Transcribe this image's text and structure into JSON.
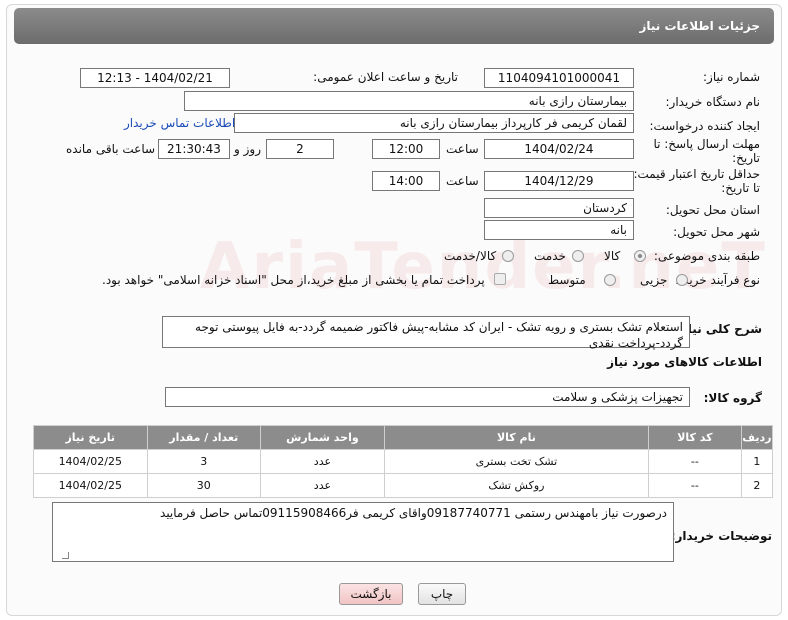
{
  "header": {
    "title": "جزئیات اطلاعات نیاز"
  },
  "fields": {
    "need_number_label": "شماره نیاز:",
    "need_number": "1104094101000041",
    "announce_label": "تاریخ و ساعت اعلان عمومی:",
    "announce_value": "1404/02/21 - 12:13",
    "buyer_org_label": "نام دستگاه خریدار:",
    "buyer_org": "بیمارستان رازی بانه",
    "creator_label": "ایجاد کننده درخواست:",
    "creator": "لقمان کریمی فر کارپرداز بیمارستان رازی بانه",
    "buyer_contact_link": "اطلاعات تماس خریدار",
    "reply_deadline_label_1": "مهلت ارسال پاسخ: تا",
    "reply_deadline_label_2": "تاریخ:",
    "reply_date": "1404/02/24",
    "time_label": "ساعت",
    "reply_time": "12:00",
    "days_value": "2",
    "days_label": "روز و",
    "remaining_time": "21:30:43",
    "remaining_label": "ساعت باقی مانده",
    "price_validity_label_1": "حداقل تاریخ اعتبار قیمت:",
    "price_validity_label_2": "تا تاریخ:",
    "price_date": "1404/12/29",
    "price_time": "14:00",
    "province_label": "استان محل تحویل:",
    "province": "کردستان",
    "city_label": "شهر محل تحویل:",
    "city": "بانه",
    "category_label": "طبقه بندی موضوعی:",
    "category_options": [
      "کالا",
      "خدمت",
      "کالا/خدمت"
    ],
    "process_label": "نوع فرآیند خرید :",
    "process_options": [
      "جزیی",
      "متوسط"
    ],
    "payment_note": "پرداخت تمام یا بخشی از مبلغ خرید،از محل \"اسناد خزانه اسلامی\" خواهد بود.",
    "description_label": "شرح کلی نیاز:",
    "description": "استعلام تشک بستری و رویه تشک - ایران کد مشابه-پیش فاکتور ضمیمه گردد-به فایل پیوستی توجه گردد-پرداخت نقدی",
    "goods_info_title": "اطلاعات کالاهای مورد نیاز",
    "goods_group_label": "گروه کالا:",
    "goods_group": "تجهیزات پزشکی و سلامت",
    "buyer_notes_label": "توضیحات خریدار:",
    "buyer_notes": "درصورت نیاز بامهندس رستمی 09187740771واقای کریمی فر09115908466تماس حاصل فرمایید"
  },
  "table": {
    "headers": [
      "ردیف",
      "کد کالا",
      "نام کالا",
      "واحد شمارش",
      "تعداد / مقدار",
      "تاریخ نیاز"
    ],
    "rows": [
      [
        "1",
        "--",
        "تشک تخت بستری",
        "عدد",
        "3",
        "1404/02/25"
      ],
      [
        "2",
        "--",
        "روکش تشک",
        "عدد",
        "30",
        "1404/02/25"
      ]
    ]
  },
  "buttons": {
    "print": "چاپ",
    "back": "بازگشت"
  },
  "watermark": "AriaTender.neT"
}
